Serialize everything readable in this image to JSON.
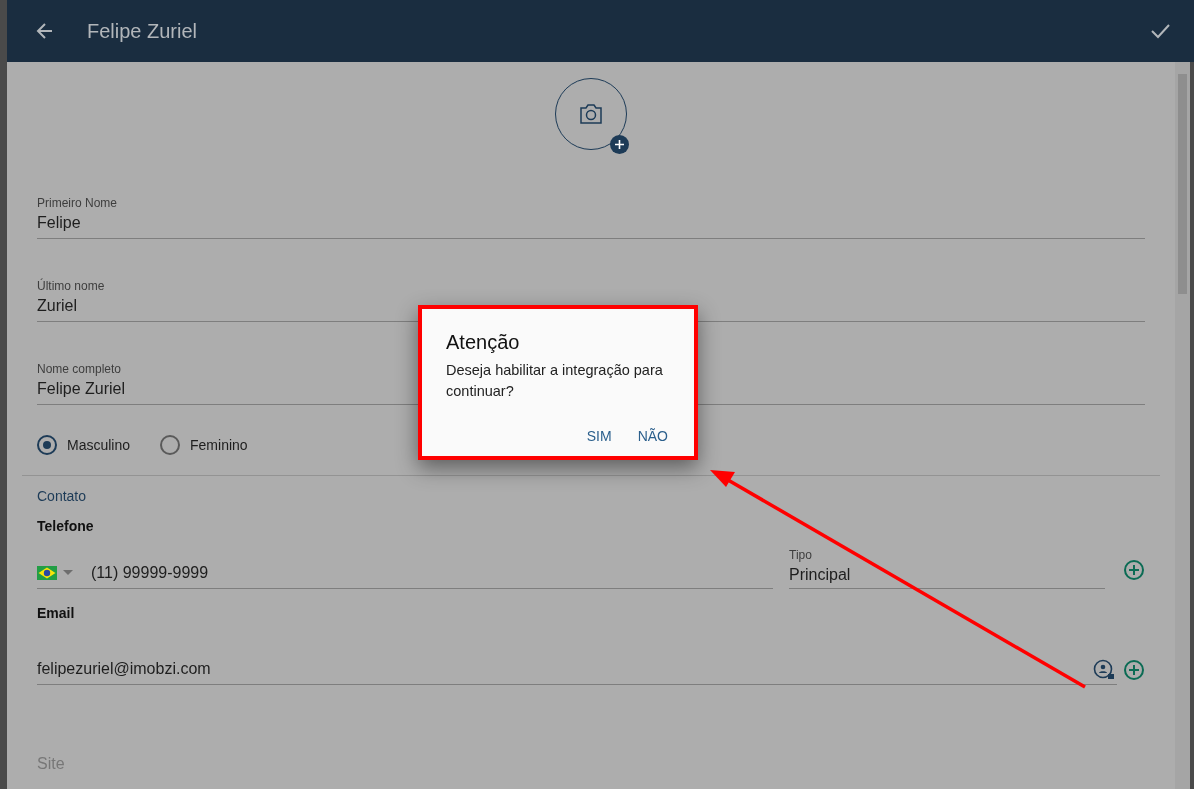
{
  "header": {
    "title": "Felipe Zuriel"
  },
  "fields": [
    {
      "label": "Primeiro Nome",
      "value": "Felipe"
    },
    {
      "label": "Último nome",
      "value": "Zuriel"
    },
    {
      "label": "Nome completo",
      "value": "Felipe Zuriel"
    }
  ],
  "gender": [
    {
      "label": "Masculino",
      "selected": true
    },
    {
      "label": "Feminino",
      "selected": false
    }
  ],
  "contact": {
    "section": "Contato",
    "phone": {
      "heading": "Telefone",
      "value": "(11) 99999-9999",
      "type_label": "Tipo",
      "type_value": "Principal"
    },
    "email": {
      "heading": "Email",
      "value": "felipezuriel@imobzi.com"
    },
    "site": {
      "placeholder": "Site"
    }
  },
  "dialog": {
    "title": "Atenção",
    "message": "Deseja habilitar a integração para continuar?",
    "buttons": [
      "SIM",
      "NÃO"
    ]
  }
}
